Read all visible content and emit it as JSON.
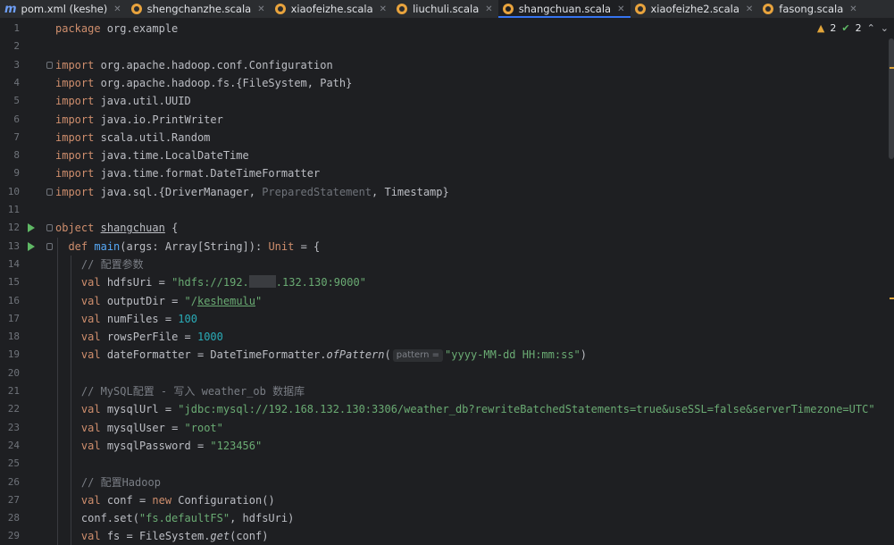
{
  "tabs": [
    {
      "label": "pom.xml (keshe)",
      "icon": "maven-icon",
      "active": false
    },
    {
      "label": "shengchanzhe.scala",
      "icon": "scala-object-icon",
      "active": false
    },
    {
      "label": "xiaofeizhe.scala",
      "icon": "scala-object-icon",
      "active": false
    },
    {
      "label": "liuchuli.scala",
      "icon": "scala-object-icon",
      "active": false
    },
    {
      "label": "shangchuan.scala",
      "icon": "scala-object-icon",
      "active": true
    },
    {
      "label": "xiaofeizhe2.scala",
      "icon": "scala-object-icon",
      "active": false
    },
    {
      "label": "fasong.scala",
      "icon": "scala-object-icon",
      "active": false
    }
  ],
  "inspections": {
    "warnings": "2",
    "weak_warnings": "2"
  },
  "editor": {
    "line_numbers": [
      "1",
      "2",
      "3",
      "4",
      "5",
      "6",
      "7",
      "8",
      "9",
      "10",
      "11",
      "12",
      "13",
      "14",
      "15",
      "16",
      "17",
      "18",
      "19",
      "20",
      "21",
      "22",
      "23",
      "24",
      "25",
      "26",
      "27",
      "28",
      "29"
    ],
    "lines": [
      [
        {
          "t": "package",
          "c": "kw"
        },
        {
          "t": " org.example"
        }
      ],
      [],
      [
        {
          "t": "import",
          "c": "kw"
        },
        {
          "t": " org.apache.hadoop.conf.Configuration"
        }
      ],
      [
        {
          "t": "import",
          "c": "kw"
        },
        {
          "t": " org.apache.hadoop.fs.{FileSystem, Path}"
        }
      ],
      [
        {
          "t": "import",
          "c": "kw"
        },
        {
          "t": " java.util.UUID"
        }
      ],
      [
        {
          "t": "import",
          "c": "kw"
        },
        {
          "t": " java.io.PrintWriter"
        }
      ],
      [
        {
          "t": "import",
          "c": "kw"
        },
        {
          "t": " scala.util.Random"
        }
      ],
      [
        {
          "t": "import",
          "c": "kw"
        },
        {
          "t": " java.time.LocalDateTime"
        }
      ],
      [
        {
          "t": "import",
          "c": "kw"
        },
        {
          "t": " java.time.format.DateTimeFormatter"
        }
      ],
      [
        {
          "t": "import",
          "c": "kw"
        },
        {
          "t": " java.sql.{DriverManager, "
        },
        {
          "t": "PreparedStatement",
          "c": "dim"
        },
        {
          "t": ", Timestamp}"
        }
      ],
      [],
      [
        {
          "t": "object",
          "c": "kw"
        },
        {
          "t": " "
        },
        {
          "t": "shangchuan",
          "c": "ul"
        },
        {
          "t": " {"
        }
      ],
      [
        {
          "t": "  "
        },
        {
          "t": "def",
          "c": "kw"
        },
        {
          "t": " "
        },
        {
          "t": "main",
          "c": "fn"
        },
        {
          "t": "(args: Array[String]): "
        },
        {
          "t": "Unit",
          "c": "kw"
        },
        {
          "t": " = {"
        }
      ],
      [
        {
          "t": "    "
        },
        {
          "t": "// 配置参数",
          "c": "cmt"
        }
      ],
      [
        {
          "t": "    "
        },
        {
          "t": "val",
          "c": "kw"
        },
        {
          "t": " hdfsUri = "
        },
        {
          "t": "\"hdfs://192.",
          "c": "str"
        },
        {
          "t": "",
          "c": "redact"
        },
        {
          "t": ".132.130:9000\"",
          "c": "str"
        }
      ],
      [
        {
          "t": "    "
        },
        {
          "t": "val",
          "c": "kw"
        },
        {
          "t": " outputDir = "
        },
        {
          "t": "\"/",
          "c": "str"
        },
        {
          "t": "keshemulu",
          "c": "str ul"
        },
        {
          "t": "\"",
          "c": "str"
        }
      ],
      [
        {
          "t": "    "
        },
        {
          "t": "val",
          "c": "kw"
        },
        {
          "t": " numFiles = "
        },
        {
          "t": "100",
          "c": "num"
        }
      ],
      [
        {
          "t": "    "
        },
        {
          "t": "val",
          "c": "kw"
        },
        {
          "t": " rowsPerFile = "
        },
        {
          "t": "1000",
          "c": "num"
        }
      ],
      [
        {
          "t": "    "
        },
        {
          "t": "val",
          "c": "kw"
        },
        {
          "t": " dateFormatter = DateTimeFormatter."
        },
        {
          "t": "ofPattern",
          "c": "it"
        },
        {
          "t": "("
        },
        {
          "t": "pattern =",
          "c": "hint"
        },
        {
          "t": "\"yyyy-MM-dd HH:mm:ss\"",
          "c": "str"
        },
        {
          "t": ")"
        }
      ],
      [],
      [
        {
          "t": "    "
        },
        {
          "t": "// MySQL配置 - 写入 weather_ob 数据库",
          "c": "cmt"
        }
      ],
      [
        {
          "t": "    "
        },
        {
          "t": "val",
          "c": "kw"
        },
        {
          "t": " mysqlUrl = "
        },
        {
          "t": "\"jdbc:mysql://192.168.132.130:3306/weather_db?rewriteBatchedStatements=true&useSSL=false&serverTimezone=UTC\"",
          "c": "str"
        }
      ],
      [
        {
          "t": "    "
        },
        {
          "t": "val",
          "c": "kw"
        },
        {
          "t": " mysqlUser = "
        },
        {
          "t": "\"root\"",
          "c": "str"
        }
      ],
      [
        {
          "t": "    "
        },
        {
          "t": "val",
          "c": "kw"
        },
        {
          "t": " mysqlPassword = "
        },
        {
          "t": "\"123456\"",
          "c": "str"
        }
      ],
      [],
      [
        {
          "t": "    "
        },
        {
          "t": "// 配置Hadoop",
          "c": "cmt"
        }
      ],
      [
        {
          "t": "    "
        },
        {
          "t": "val",
          "c": "kw"
        },
        {
          "t": " conf = "
        },
        {
          "t": "new",
          "c": "kw"
        },
        {
          "t": " Configuration()"
        }
      ],
      [
        {
          "t": "    conf.set("
        },
        {
          "t": "\"fs.defaultFS\"",
          "c": "str"
        },
        {
          "t": ", hdfsUri)"
        }
      ],
      [
        {
          "t": "    "
        },
        {
          "t": "val",
          "c": "kw"
        },
        {
          "t": " fs = FileSystem."
        },
        {
          "t": "get",
          "c": "it"
        },
        {
          "t": "(conf)"
        }
      ]
    ]
  }
}
